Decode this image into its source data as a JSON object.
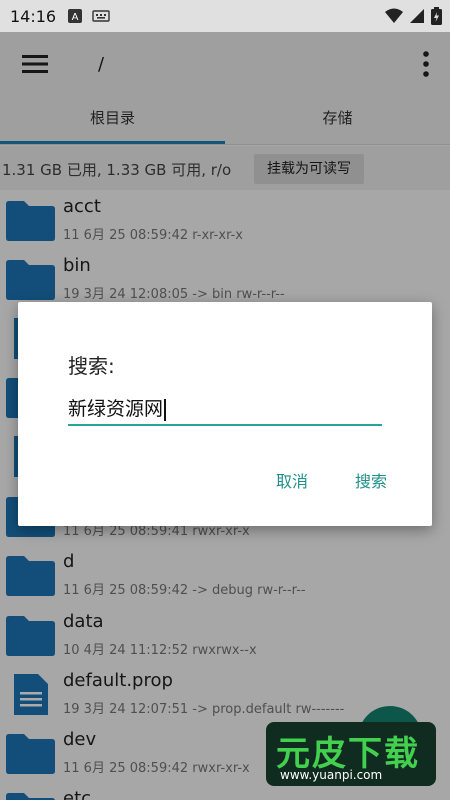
{
  "status": {
    "time": "14:16"
  },
  "appbar": {
    "path": "/"
  },
  "tabs": [
    "根目录",
    "存储"
  ],
  "storage": {
    "info": "1.31 GB 已用, 1.33 GB 可用, r/o",
    "mount_label": "挂载为可读写"
  },
  "files": [
    {
      "name": "acct",
      "meta": "11 6月 25 08:59:42   r-xr-xr-x",
      "kind": "folder"
    },
    {
      "name": "bin",
      "meta": "19 3月 24 12:08:05  -> bin  rw-r--r--",
      "kind": "folder"
    },
    {
      "name": "",
      "meta": "",
      "kind": "file"
    },
    {
      "name": "",
      "meta": "",
      "kind": "folder"
    },
    {
      "name": "",
      "meta": "",
      "kind": "file"
    },
    {
      "name": "",
      "meta": "11 6月 25 08:59:41   rwxr-xr-x",
      "kind": "folder"
    },
    {
      "name": "d",
      "meta": "11 6月 25 08:59:42  -> debug  rw-r--r--",
      "kind": "folder"
    },
    {
      "name": "data",
      "meta": "10 4月 24 11:12:52   rwxrwx--x",
      "kind": "folder"
    },
    {
      "name": "default.prop",
      "meta": "19 3月 24 12:07:51  -> prop.default  rw-------",
      "kind": "file"
    },
    {
      "name": "dev",
      "meta": "11 6月 25 08:59:42   rwxr-xr-x",
      "kind": "folder"
    },
    {
      "name": "etc",
      "meta": "",
      "kind": "folder"
    }
  ],
  "dialog": {
    "title": "搜索:",
    "input_value": "新绿资源网",
    "cancel_label": "取消",
    "search_label": "搜索"
  },
  "watermark": {
    "text": "元皮下载",
    "url": "www.yuanpi.com"
  },
  "colors": {
    "accent": "#1e7fb8",
    "folder": "#1b75b5",
    "dialog_accent": "#26a69a"
  }
}
